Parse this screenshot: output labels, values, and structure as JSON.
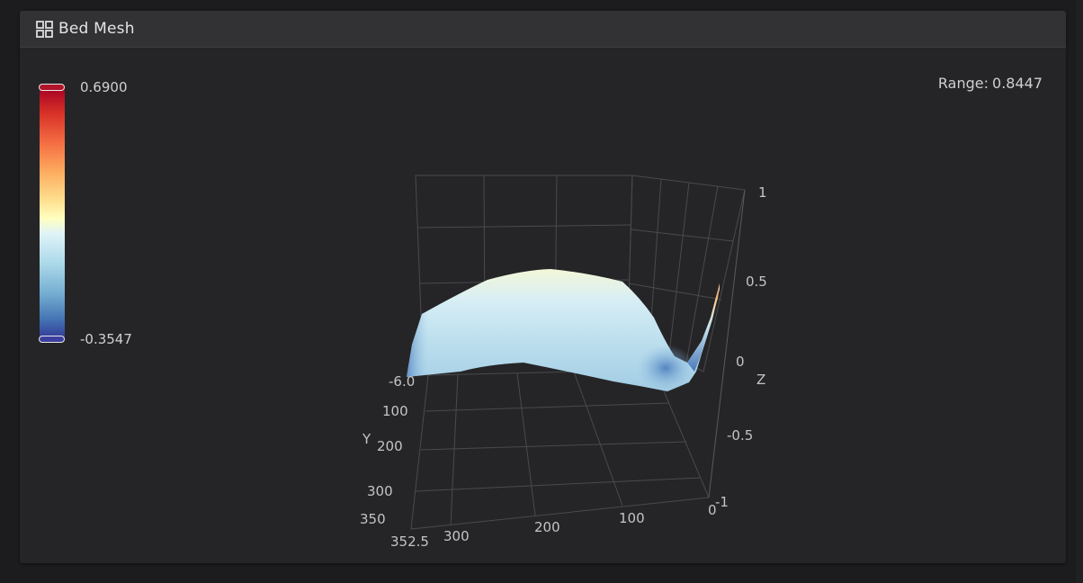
{
  "panel": {
    "title": "Bed Mesh",
    "icon": "grid-icon"
  },
  "colorbar": {
    "max_label": "0.6900",
    "min_label": "-0.3547",
    "colorscale": [
      "#a50026",
      "#d73027",
      "#f46d43",
      "#fdae61",
      "#fee090",
      "#ffffbf",
      "#e0f3f8",
      "#abd9e9",
      "#74add1",
      "#4575b4",
      "#313695"
    ]
  },
  "range": {
    "label": "Range:",
    "value": "0.8447"
  },
  "axes": {
    "y_label": "Y",
    "z_label": "Z",
    "y_ticks": [
      "-6.0",
      "100",
      "200",
      "300",
      "350"
    ],
    "x_ticks": [
      "352.5",
      "300",
      "200",
      "100",
      "-1",
      "0"
    ],
    "z_ticks": [
      "1",
      "0.5",
      "0",
      "-0.5"
    ]
  },
  "chart_data": {
    "type": "surface",
    "title": "",
    "xlabel": "",
    "ylabel": "Y",
    "zlabel": "Z",
    "zlim": [
      -1,
      1
    ],
    "color_range": [
      -0.3547,
      0.69
    ]
  }
}
